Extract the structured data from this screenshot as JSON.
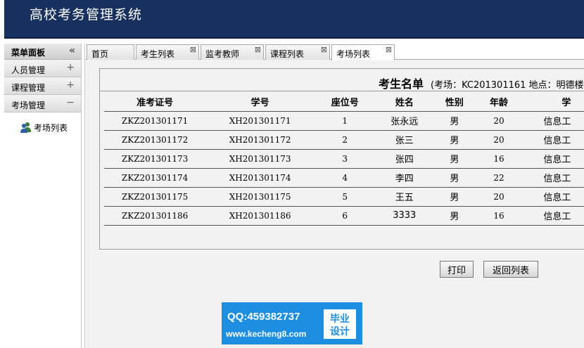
{
  "app": {
    "title": "高校考务管理系统"
  },
  "sidebar": {
    "header": "菜单面板",
    "collapse_glyph": "«",
    "items": [
      {
        "label": "人员管理",
        "sign": "+"
      },
      {
        "label": "课程管理",
        "sign": "+"
      },
      {
        "label": "考场管理",
        "sign": "−"
      }
    ],
    "subitems": [
      {
        "label": "考场列表",
        "icon": "users-icon"
      }
    ]
  },
  "tabs": [
    {
      "label": "首页",
      "closable": false
    },
    {
      "label": "考生列表",
      "closable": true
    },
    {
      "label": "监考教师",
      "closable": true
    },
    {
      "label": "课程列表",
      "closable": true
    },
    {
      "label": "考场列表",
      "closable": true,
      "active": true
    }
  ],
  "roster": {
    "title": "考生名单",
    "subtitle": "(考场：KC201301161 地点：明德楼",
    "columns": [
      "准考证号",
      "学号",
      "座位号",
      "姓名",
      "性别",
      "年龄",
      "学"
    ],
    "rows": [
      [
        "ZKZ201301171",
        "XH201301171",
        "1",
        "张永远",
        "男",
        "20",
        "信息工"
      ],
      [
        "ZKZ201301172",
        "XH201301172",
        "2",
        "张三",
        "男",
        "20",
        "信息工"
      ],
      [
        "ZKZ201301173",
        "XH201301173",
        "3",
        "张四",
        "男",
        "16",
        "信息工"
      ],
      [
        "ZKZ201301174",
        "XH201301174",
        "4",
        "李四",
        "男",
        "22",
        "信息工"
      ],
      [
        "ZKZ201301175",
        "XH201301175",
        "5",
        "王五",
        "男",
        "20",
        "信息工"
      ],
      [
        "ZKZ201301186",
        "XH201301186",
        "6",
        "3333",
        "男",
        "16",
        "信息工"
      ]
    ]
  },
  "buttons": {
    "print": "打印",
    "back": "返回列表"
  },
  "watermark": {
    "qq": "QQ:459382737",
    "site": "www.kecheng8.com",
    "badge_line1": "毕业",
    "badge_line2": "设计"
  },
  "colors": {
    "header_bg": "#17305e",
    "watermark_bg": "#1e8ee0"
  }
}
